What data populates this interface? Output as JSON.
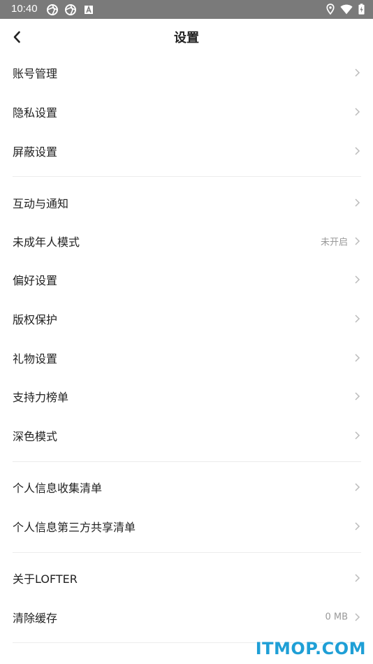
{
  "status_bar": {
    "time": "10:40"
  },
  "header": {
    "title": "设置"
  },
  "groups": [
    {
      "items": [
        {
          "label": "账号管理",
          "value": ""
        },
        {
          "label": "隐私设置",
          "value": ""
        },
        {
          "label": "屏蔽设置",
          "value": ""
        }
      ]
    },
    {
      "items": [
        {
          "label": "互动与通知",
          "value": ""
        },
        {
          "label": "未成年人模式",
          "value": "未开启"
        },
        {
          "label": "偏好设置",
          "value": ""
        },
        {
          "label": "版权保护",
          "value": ""
        },
        {
          "label": "礼物设置",
          "value": ""
        },
        {
          "label": "支持力榜单",
          "value": ""
        },
        {
          "label": "深色模式",
          "value": ""
        }
      ]
    },
    {
      "items": [
        {
          "label": "个人信息收集清单",
          "value": ""
        },
        {
          "label": "个人信息第三方共享清单",
          "value": ""
        }
      ]
    },
    {
      "items": [
        {
          "label": "关于LOFTER",
          "value": ""
        },
        {
          "label": "清除缓存",
          "value": "0 MB"
        }
      ]
    }
  ],
  "watermark": "ITMOP.COM",
  "colors": {
    "status_bar_bg": "#7a7a7a",
    "divider": "#ececec",
    "watermark": "#1f9fd6"
  }
}
